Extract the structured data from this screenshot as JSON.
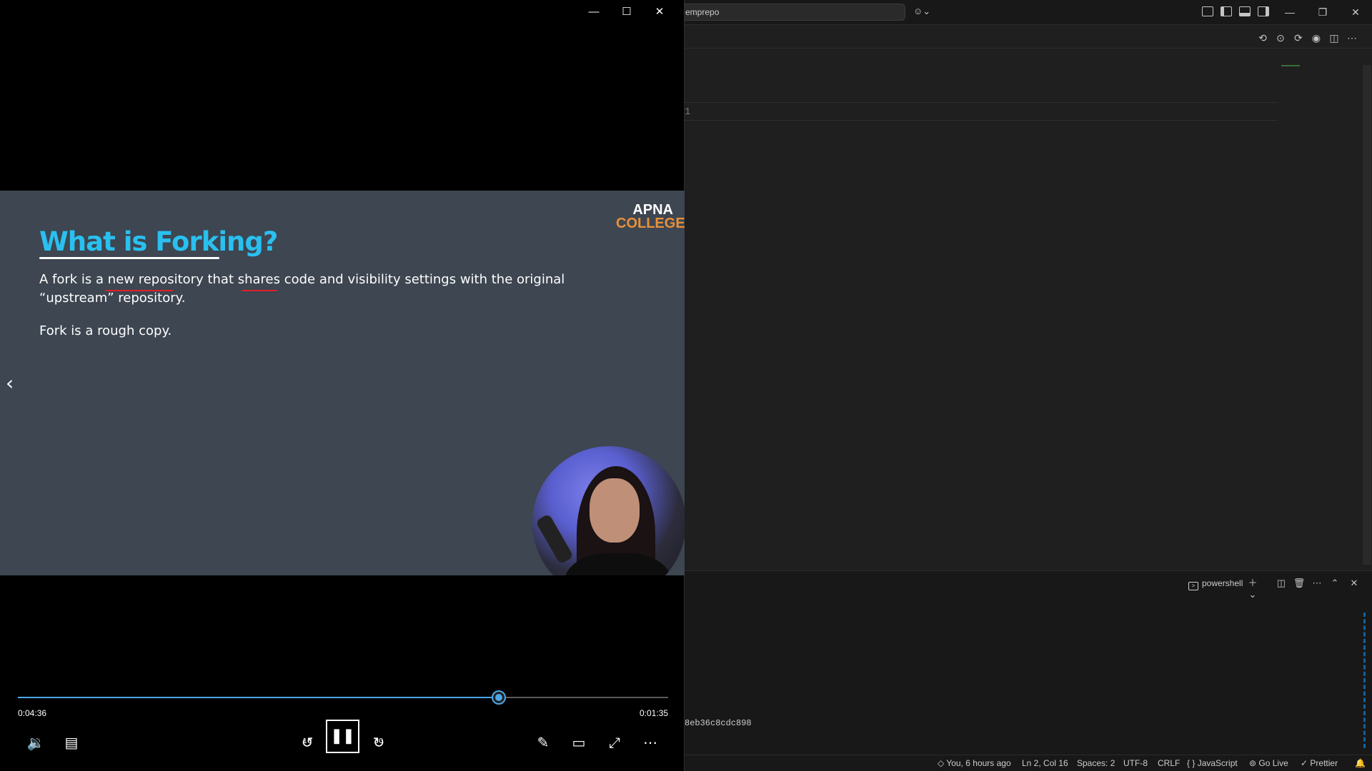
{
  "vscode": {
    "search_text": "emprepo",
    "terminal": {
      "tab_label": "powershell",
      "output_line": "8eb36c8cdc898"
    },
    "editor": {
      "line_number": "1"
    },
    "statusbar": {
      "blame": "You, 6 hours ago",
      "cursor": "Ln 2, Col 16",
      "spaces": "Spaces: 2",
      "encoding": "UTF-8",
      "eol": "CRLF",
      "language": "JavaScript",
      "golive": "Go Live",
      "prettier": "Prettier"
    }
  },
  "player": {
    "slide": {
      "title": "What is Forking?",
      "text1": "A fork is a new repository that shares code and visibility settings with the original “upstream” repository.",
      "text2": "Fork is a rough copy.",
      "logo_line1": "APNA",
      "logo_line2": "COLLEGE"
    },
    "time_elapsed": "0:04:36",
    "time_remaining": "0:01:35",
    "progress_fraction": 0.74,
    "skip_back_label": "10",
    "skip_forward_label": "30",
    "accent_color": "#4aa8e8"
  }
}
